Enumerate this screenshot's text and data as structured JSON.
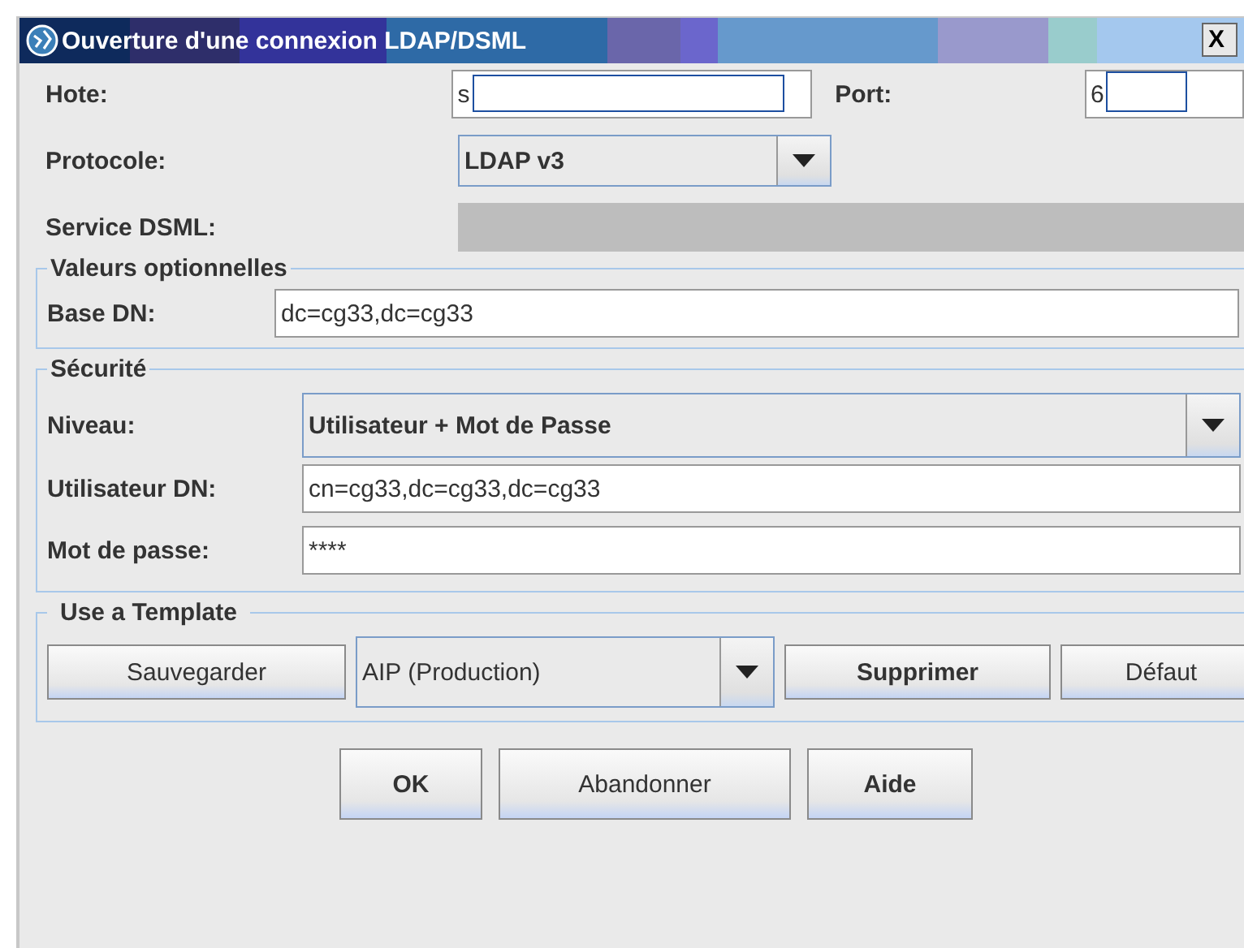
{
  "window": {
    "title": "Ouverture d'une connexion LDAP/DSML",
    "close": "X"
  },
  "connection": {
    "host_label": "Hote:",
    "host_value": "s",
    "port_label": "Port:",
    "port_value": "6",
    "protocol_label": "Protocole:",
    "protocol_value": "LDAP v3",
    "dsml_label": "Service DSML:",
    "dsml_disabled": true
  },
  "optional": {
    "legend": "Valeurs optionnelles",
    "base_dn_label": "Base DN:",
    "base_dn_value": "dc=cg33,dc=cg33"
  },
  "security": {
    "legend": "Sécurité",
    "level_label": "Niveau:",
    "level_value": "Utilisateur + Mot de Passe",
    "user_dn_label": "Utilisateur DN:",
    "user_dn_value": "cn=cg33,dc=cg33,dc=cg33",
    "password_label": "Mot de passe:",
    "password_value": "****"
  },
  "template": {
    "legend": "Use a Template",
    "save": "Sauvegarder",
    "selected_template": "AIP (Production)",
    "delete": "Supprimer",
    "default": "Défaut"
  },
  "buttons": [
    "OK",
    "Abandonner",
    "Aide"
  ]
}
